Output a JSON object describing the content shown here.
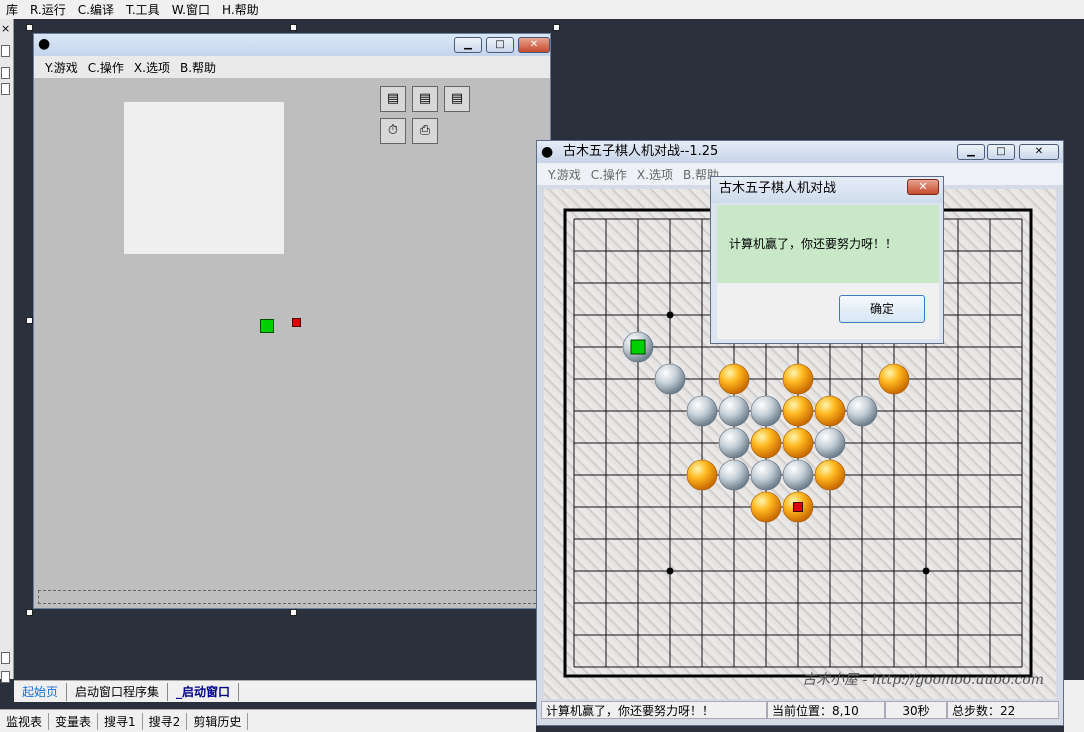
{
  "ide_menu": [
    "库",
    "R.运行",
    "C.编译",
    "T.工具",
    "W.窗口",
    "H.帮助"
  ],
  "designer": {
    "menu": [
      "Y.游戏",
      "C.操作",
      "X.选项",
      "B.帮助"
    ]
  },
  "game": {
    "title": "古木五子棋人机对战--1.25",
    "menu": [
      "Y.游戏",
      "C.操作",
      "X.选项",
      "B.帮助"
    ],
    "watermark": "古木小屋 - http://goomoo.uuoo.com",
    "status": {
      "message": "计算机赢了，你还要努力呀！！",
      "position": "当前位置：8,10",
      "time": "30秒",
      "steps": "总步数：22"
    },
    "board": {
      "size": 15,
      "star_points": [
        [
          3,
          3
        ],
        [
          11,
          3
        ],
        [
          3,
          11
        ],
        [
          11,
          11
        ]
      ],
      "white_stones": [
        [
          2,
          4
        ],
        [
          3,
          5
        ],
        [
          4,
          6
        ],
        [
          5,
          6
        ],
        [
          6,
          6
        ],
        [
          9,
          6
        ],
        [
          5,
          7
        ],
        [
          8,
          7
        ],
        [
          5,
          8
        ],
        [
          6,
          8
        ],
        [
          7,
          8
        ]
      ],
      "gold_stones": [
        [
          5,
          5
        ],
        [
          7,
          5
        ],
        [
          10,
          5
        ],
        [
          7,
          6
        ],
        [
          8,
          6
        ],
        [
          6,
          7
        ],
        [
          7,
          7
        ],
        [
          4,
          8
        ],
        [
          8,
          8
        ],
        [
          6,
          9
        ],
        [
          7,
          9
        ]
      ],
      "last_move_white": [
        2,
        4
      ],
      "last_move_gold": [
        7,
        9
      ]
    }
  },
  "dialog": {
    "title": "古木五子棋人机对战",
    "message": "计算机赢了，你还要努力呀！！",
    "ok": "确定"
  },
  "doc_tabs": [
    "起始页",
    "启动窗口程序集",
    "_启动窗口"
  ],
  "panel_tabs": [
    "监视表",
    "变量表",
    "搜寻1",
    "搜寻2",
    "剪辑历史"
  ]
}
